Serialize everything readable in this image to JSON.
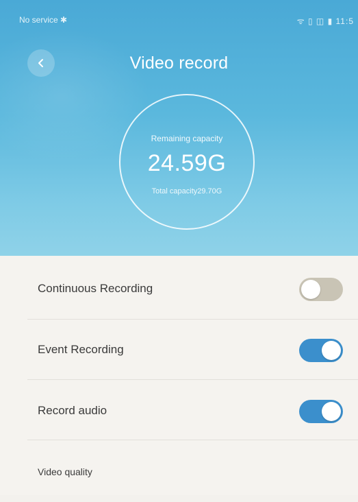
{
  "status_bar": {
    "carrier": "No service ✱",
    "indicators": "ᯤ ▯ ◫ ▮ 11:5"
  },
  "header": {
    "title": "Video record",
    "back_icon": "chevron-left-icon"
  },
  "capacity": {
    "remaining_label": "Remaining capacity",
    "remaining_value": "24.59G",
    "total_label": "Total capacity29.70G"
  },
  "settings": {
    "continuous_recording": {
      "label": "Continuous Recording",
      "enabled": false
    },
    "event_recording": {
      "label": "Event Recording",
      "enabled": true
    },
    "record_audio": {
      "label": "Record audio",
      "enabled": true
    },
    "video_quality": {
      "label": "Video quality"
    }
  },
  "colors": {
    "header_top": "#4aa9d6",
    "header_bottom": "#8fd2e8",
    "toggle_on": "#3b8fcc",
    "toggle_off": "#c9c4b5",
    "background": "#f5f3ef"
  }
}
